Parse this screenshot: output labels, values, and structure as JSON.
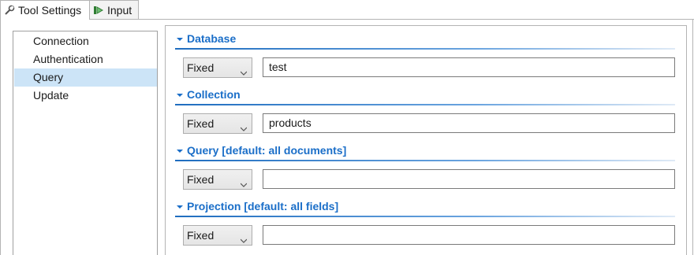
{
  "tabs": [
    {
      "label": "Tool Settings",
      "icon": "wrench-icon",
      "active": true
    },
    {
      "label": "Input",
      "icon": "input-port-icon",
      "active": false
    }
  ],
  "nav": {
    "items": [
      {
        "label": "Connection",
        "selected": false
      },
      {
        "label": "Authentication",
        "selected": false
      },
      {
        "label": "Query",
        "selected": true
      },
      {
        "label": "Update",
        "selected": false
      }
    ]
  },
  "sections": [
    {
      "title": "Database",
      "mode": "Fixed",
      "value": "test"
    },
    {
      "title": "Collection",
      "mode": "Fixed",
      "value": "products"
    },
    {
      "title": "Query [default: all documents]",
      "mode": "Fixed",
      "value": ""
    },
    {
      "title": "Projection [default: all fields]",
      "mode": "Fixed",
      "value": ""
    }
  ],
  "colors": {
    "section_title": "#1a6ec8",
    "selection": "#cce4f7"
  }
}
